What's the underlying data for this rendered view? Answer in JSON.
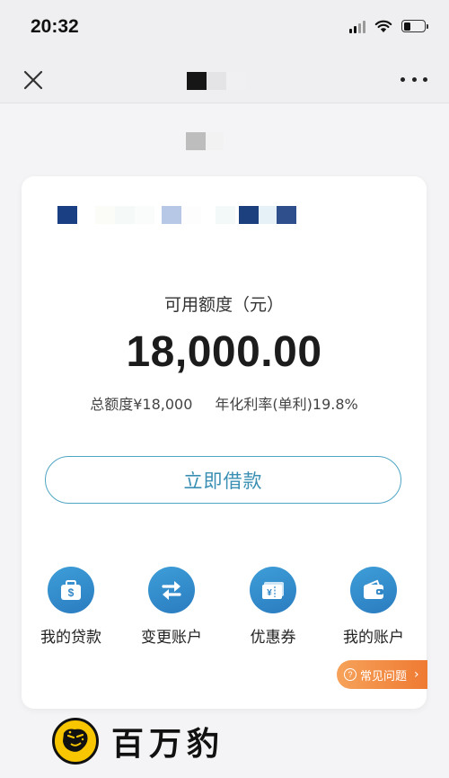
{
  "status_bar": {
    "time": "20:32",
    "signal_icon": "cellular-signal-icon",
    "wifi_icon": "wifi-icon",
    "battery_icon": "battery-icon",
    "battery_level": 0.35
  },
  "nav": {
    "close_icon": "close-icon",
    "more_icon": "more-dots-icon"
  },
  "card": {
    "credit_label": "可用额度（元）",
    "credit_amount": "18,000.00",
    "total_credit": "总额度¥18,000",
    "annual_rate": "年化利率(单利)19.8%",
    "borrow_button": "立即借款"
  },
  "quick_menu": [
    {
      "label": "我的贷款",
      "icon": "money-bag-icon"
    },
    {
      "label": "变更账户",
      "icon": "swap-arrows-icon"
    },
    {
      "label": "优惠券",
      "icon": "coupon-icon"
    },
    {
      "label": "我的账户",
      "icon": "wallet-icon"
    }
  ],
  "faq": {
    "label": "常见问题",
    "icon": "question-icon"
  },
  "watermark": {
    "text": "百万豹",
    "logo": "leopard-logo"
  },
  "colors": {
    "accent": "#3a8fb3",
    "icon_blue": "#2a7cc0",
    "faq_orange": "#ef7a32",
    "background": "#f4f4f6"
  }
}
